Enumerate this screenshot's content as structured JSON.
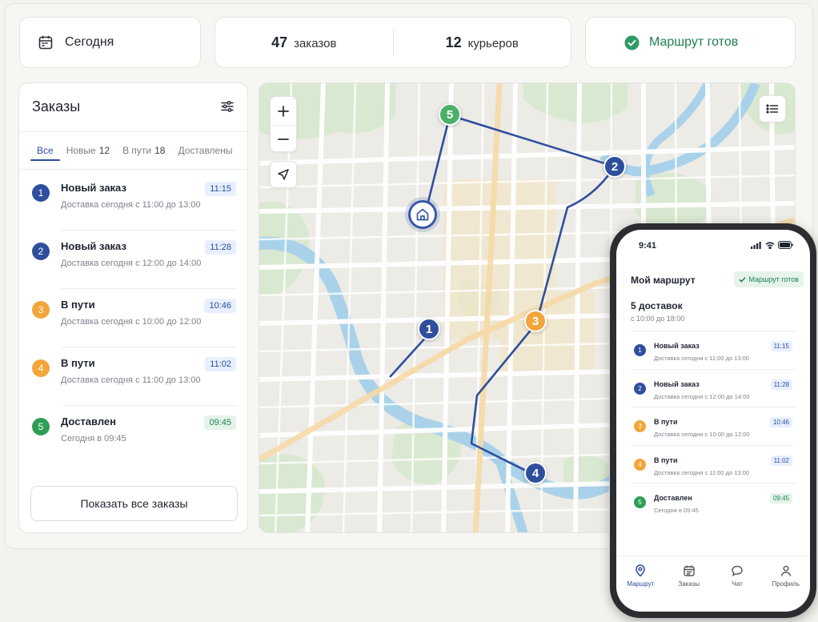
{
  "summary": {
    "date_label": "Сегодня",
    "orders_count": "47",
    "orders_label": "заказов",
    "couriers_count": "12",
    "couriers_label": "курьеров",
    "route_status": "Маршрут готов"
  },
  "orders_panel": {
    "title": "Заказы",
    "tabs": [
      {
        "label": "Все",
        "count": ""
      },
      {
        "label": "Новые",
        "count": "12"
      },
      {
        "label": "В пути",
        "count": "18"
      },
      {
        "label": "Доставлены",
        "count": ""
      }
    ],
    "items": [
      {
        "num": "1",
        "title": "Новый заказ",
        "subtitle": "Доставка сегодня с 11:00 до 13:00",
        "time": "11:15",
        "color": "#2f4f9e"
      },
      {
        "num": "2",
        "title": "Новый заказ",
        "subtitle": "Доставка сегодня с 12:00 до 14:00",
        "time": "11:28",
        "color": "#2f4f9e"
      },
      {
        "num": "3",
        "title": "В пути",
        "subtitle": "Доставка сегодня с 10:00 до 12:00",
        "time": "10:46",
        "color": "#f2a53a"
      },
      {
        "num": "4",
        "title": "В пути",
        "subtitle": "Доставка сегодня с 11:00 до 13:00",
        "time": "11:02",
        "color": "#f2a53a"
      },
      {
        "num": "5",
        "title": "Доставлен",
        "subtitle": "Сегодня в 09:45",
        "time": "09:45",
        "color": "#2e9e55"
      }
    ],
    "show_all": "Показать все заказы"
  },
  "map": {
    "zoom_in": "+",
    "zoom_out": "−",
    "markers": [
      {
        "num": "1",
        "color": "#2f4f9e"
      },
      {
        "num": "2",
        "color": "#2f4f9e"
      },
      {
        "num": "3",
        "color": "#f2a53a"
      },
      {
        "num": "4",
        "color": "#2f4f9e"
      },
      {
        "num": "5",
        "color": "#4caf6a"
      }
    ],
    "route_color": "#2f4f9e"
  },
  "phone": {
    "time": "9:41",
    "title": "Мой маршрут",
    "status": "Маршрут готов",
    "deliveries": "5 доставок",
    "range": "с 10:00 до 18:00",
    "items": [
      {
        "num": "1",
        "title": "Новый заказ",
        "subtitle": "Доставка сегодня с 11:00 до 13:00",
        "time": "11:15",
        "color": "#2f4f9e"
      },
      {
        "num": "2",
        "title": "Новый заказ",
        "subtitle": "Доставка сегодня с 12:00 до 14:00",
        "time": "11:28",
        "color": "#2f4f9e"
      },
      {
        "num": "3",
        "title": "В пути",
        "subtitle": "Доставка сегодня с 10:00 до 12:00",
        "time": "10:46",
        "color": "#f2a53a"
      },
      {
        "num": "4",
        "title": "В пути",
        "subtitle": "Доставка сегодня с 11:00 до 13:00",
        "time": "11:02",
        "color": "#f2a53a"
      },
      {
        "num": "5",
        "title": "Доставлен",
        "subtitle": "Сегодня в 09:45",
        "time": "09:45",
        "color": "#2e9e55"
      }
    ],
    "nav": [
      {
        "label": "Маршрут",
        "icon": "route-pin-icon"
      },
      {
        "label": "Заказы",
        "icon": "calendar-icon"
      },
      {
        "label": "Чат",
        "icon": "chat-icon"
      },
      {
        "label": "Профиль",
        "icon": "user-icon"
      }
    ]
  }
}
